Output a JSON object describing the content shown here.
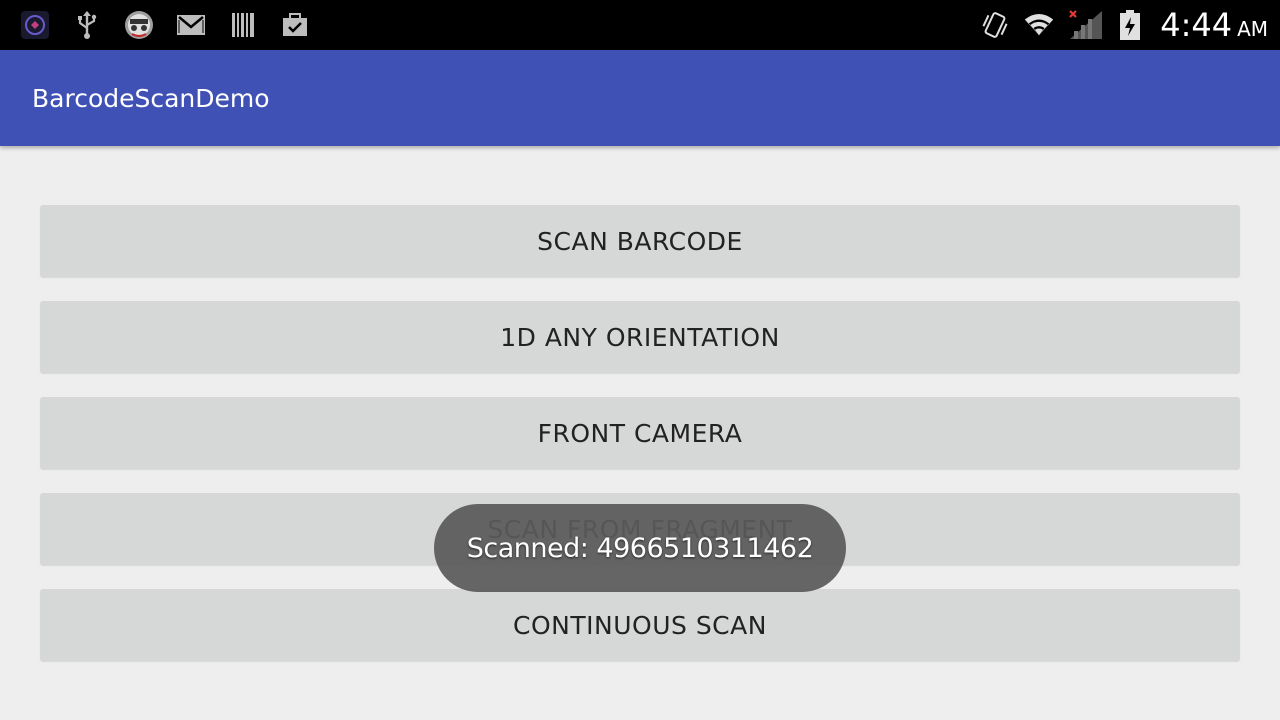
{
  "status_bar": {
    "left_icons": [
      "app-notification-icon",
      "usb-icon",
      "incognito-icon",
      "gmail-icon",
      "barcode-icon",
      "clipboard-check-icon"
    ],
    "right_icons": [
      "vibrate-icon",
      "wifi-icon",
      "cellular-no-signal-icon",
      "battery-charging-icon"
    ],
    "time": "4:44",
    "ampm": "AM"
  },
  "app_bar": {
    "title": "BarcodeScanDemo",
    "color": "#3f51b5"
  },
  "buttons": [
    {
      "label": "SCAN BARCODE"
    },
    {
      "label": "1D ANY ORIENTATION"
    },
    {
      "label": "FRONT CAMERA"
    },
    {
      "label": "SCAN FROM FRAGMENT"
    },
    {
      "label": "CONTINUOUS SCAN"
    }
  ],
  "toast": {
    "message": "Scanned: 4966510311462"
  }
}
